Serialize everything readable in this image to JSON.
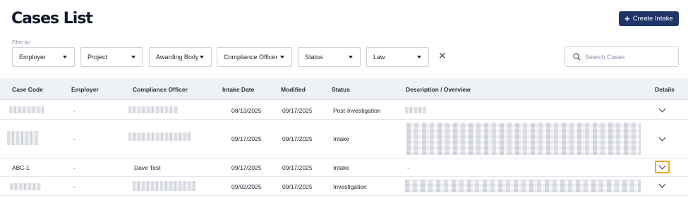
{
  "page": {
    "title": "Cases List"
  },
  "toolbar": {
    "create_label": "Create Intake",
    "create_icon": "plus-icon"
  },
  "filters": {
    "label": "Filter by:",
    "items": [
      {
        "label": "Employer"
      },
      {
        "label": "Project"
      },
      {
        "label": "Awarding Body"
      },
      {
        "label": "Compliance Officer"
      },
      {
        "label": "Status"
      },
      {
        "label": "Law"
      }
    ],
    "clear_icon": "close-icon"
  },
  "search": {
    "placeholder": "Search Cases",
    "value": "",
    "icon": "search-icon"
  },
  "table": {
    "headers": [
      "Case Code",
      "Employer",
      "Compliance Officer",
      "Intake Date",
      "Modified",
      "Status",
      "Description / Overview",
      "Details"
    ],
    "rows": [
      {
        "case_code": "",
        "employer": "-",
        "officer": "",
        "intake_date": "08/13/2025",
        "modified": "09/17/2025",
        "status": "Post-Investigation",
        "description": ""
      },
      {
        "case_code": "",
        "employer": "-",
        "officer": "",
        "intake_date": "09/17/2025",
        "modified": "09/17/2025",
        "status": "Intake",
        "description": ""
      },
      {
        "case_code": "ABC-1",
        "employer": "-",
        "officer": "Dave Test",
        "intake_date": "09/17/2025",
        "modified": "09/17/2025",
        "status": "Intake",
        "description": "-"
      },
      {
        "case_code": "",
        "employer": "-",
        "officer": "",
        "intake_date": "09/02/2025",
        "modified": "09/17/2025",
        "status": "Investigation",
        "description": ""
      }
    ]
  },
  "colors": {
    "primary": "#1f3569",
    "highlight": "#f5a623",
    "header_bg": "#eef1f6"
  }
}
